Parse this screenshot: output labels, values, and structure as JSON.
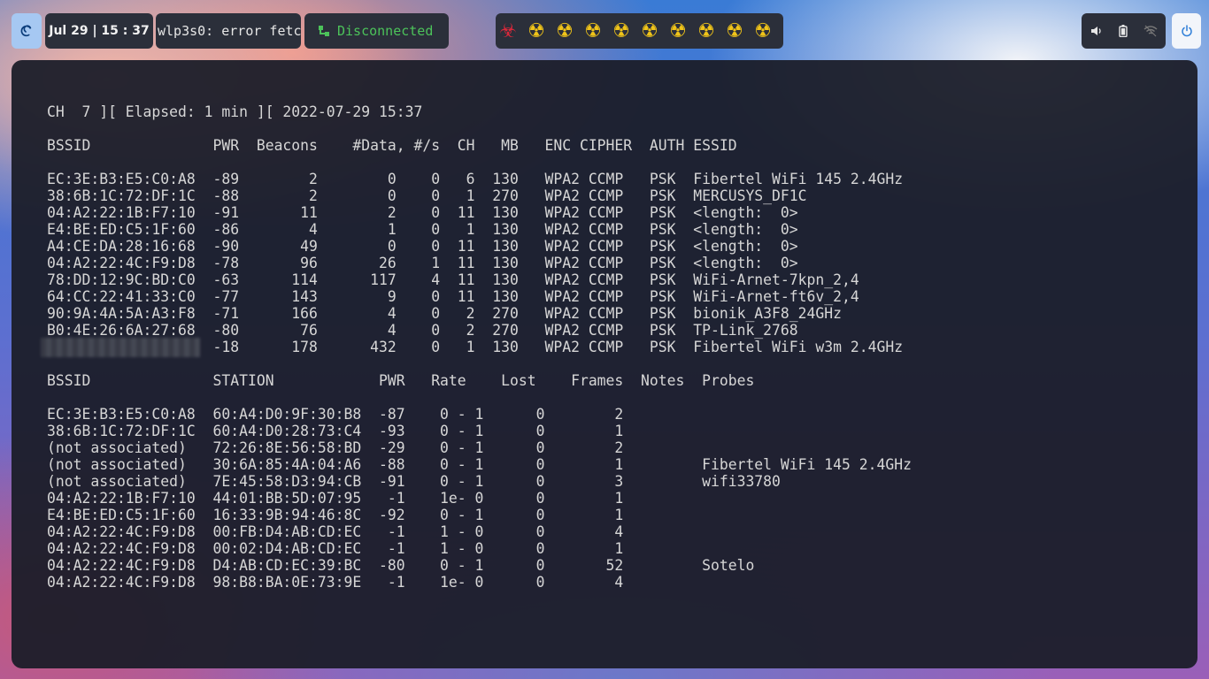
{
  "panel": {
    "clock": "Jul 29 | 15 : 37",
    "network_status": "wlp3s0: error fetc",
    "connection": "Disconnected",
    "workspace_icons": [
      "biohazard-icon",
      "radioactive-icon",
      "radioactive-icon",
      "radioactive-icon",
      "radioactive-icon",
      "radioactive-icon",
      "radioactive-icon",
      "radioactive-icon",
      "radioactive-icon",
      "radioactive-icon"
    ]
  },
  "terminal": {
    "status_line": "CH  7 ][ Elapsed: 1 min ][ 2022-07-29 15:37",
    "ap_header": "BSSID              PWR  Beacons    #Data, #/s  CH   MB   ENC CIPHER  AUTH ESSID",
    "ap_rows": [
      "EC:3E:B3:E5:C0:A8  -89        2        0    0   6  130   WPA2 CCMP   PSK  Fibertel WiFi 145 2.4GHz",
      "38:6B:1C:72:DF:1C  -88        2        0    0   1  270   WPA2 CCMP   PSK  MERCUSYS_DF1C",
      "04:A2:22:1B:F7:10  -91       11        2    0  11  130   WPA2 CCMP   PSK  <length:  0>",
      "E4:BE:ED:C5:1F:60  -86        4        1    0   1  130   WPA2 CCMP   PSK  <length:  0>",
      "A4:CE:DA:28:16:68  -90       49        0    0  11  130   WPA2 CCMP   PSK  <length:  0>",
      "04:A2:22:4C:F9:D8  -78       96       26    1  11  130   WPA2 CCMP   PSK  <length:  0>",
      "78:DD:12:9C:BD:C0  -63      114      117    4  11  130   WPA2 CCMP   PSK  WiFi-Arnet-7kpn_2,4",
      "64:CC:22:41:33:C0  -77      143        9    0  11  130   WPA2 CCMP   PSK  WiFi-Arnet-ft6v_2,4",
      "90:9A:4A:5A:A3:F8  -71      166        4    0   2  270   WPA2 CCMP   PSK  bionik_A3F8_24GHz",
      "B0:4E:26:6A:27:68  -80       76        4    0   2  270   WPA2 CCMP   PSK  TP-Link_2768",
      "                   -18      178      432    0   1  130   WPA2 CCMP   PSK  Fibertel WiFi w3m 2.4GHz"
    ],
    "station_header": "BSSID              STATION            PWR   Rate    Lost    Frames  Notes  Probes",
    "station_rows": [
      "EC:3E:B3:E5:C0:A8  60:A4:D0:9F:30:B8  -87    0 - 1      0        2",
      "38:6B:1C:72:DF:1C  60:A4:D0:28:73:C4  -93    0 - 1      0        1",
      "(not associated)   72:26:8E:56:58:BD  -29    0 - 1      0        2",
      "(not associated)   30:6A:85:4A:04:A6  -88    0 - 1      0        1         Fibertel WiFi 145 2.4GHz",
      "(not associated)   7E:45:58:D3:94:CB  -91    0 - 1      0        3         wifi33780",
      "04:A2:22:1B:F7:10  44:01:BB:5D:07:95   -1    1e- 0      0        1",
      "E4:BE:ED:C5:1F:60  16:33:9B:94:46:8C  -92    0 - 1      0        1",
      "04:A2:22:4C:F9:D8  00:FB:D4:AB:CD:EC   -1    1 - 0      0        4",
      "04:A2:22:4C:F9:D8  00:02:D4:AB:CD:EC   -1    1 - 0      0        1",
      "04:A2:22:4C:F9:D8  D4:AB:CD:EC:39:BC  -80    0 - 1      0       52         Sotelo",
      "04:A2:22:4C:F9:D8  98:B8:BA:0E:73:9E   -1    1e- 0      0        4"
    ]
  }
}
